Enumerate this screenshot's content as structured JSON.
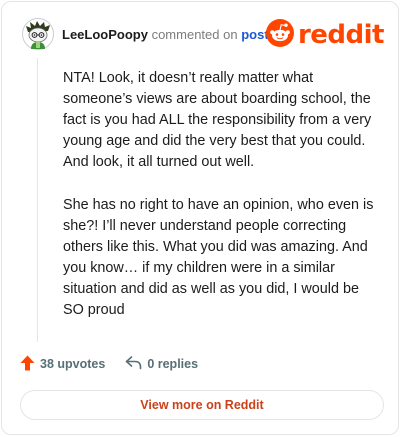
{
  "header": {
    "username": "LeeLooPoopy",
    "action_text": "commented on",
    "post_link": "post",
    "logo_text": "reddit"
  },
  "comment": {
    "paragraphs": [
      "NTA! Look, it doesn’t really matter what someone’s views are about boarding school, the fact is you had ALL the responsibility from a very young age and did the very best that you could. And look, it all turned out well.",
      "She has no right to have an opinion, who even is she?! I’ll never understand people correcting others like this. What you did was amazing. And you know… if my children were in a similar situation and did as well as you did, I would be SO proud"
    ]
  },
  "actions": {
    "upvotes": "38 upvotes",
    "replies": "0 replies"
  },
  "view_more_label": "View more on Reddit",
  "colors": {
    "brand": "#ff4500",
    "link": "#1a56db",
    "muted": "#7c7c7c",
    "view_more": "#c9421b"
  },
  "icons": {
    "avatar": "snoo-avatar-icon",
    "logo": "reddit-snoo-icon",
    "upvote": "upvote-arrow-icon",
    "reply": "reply-arrow-icon"
  }
}
